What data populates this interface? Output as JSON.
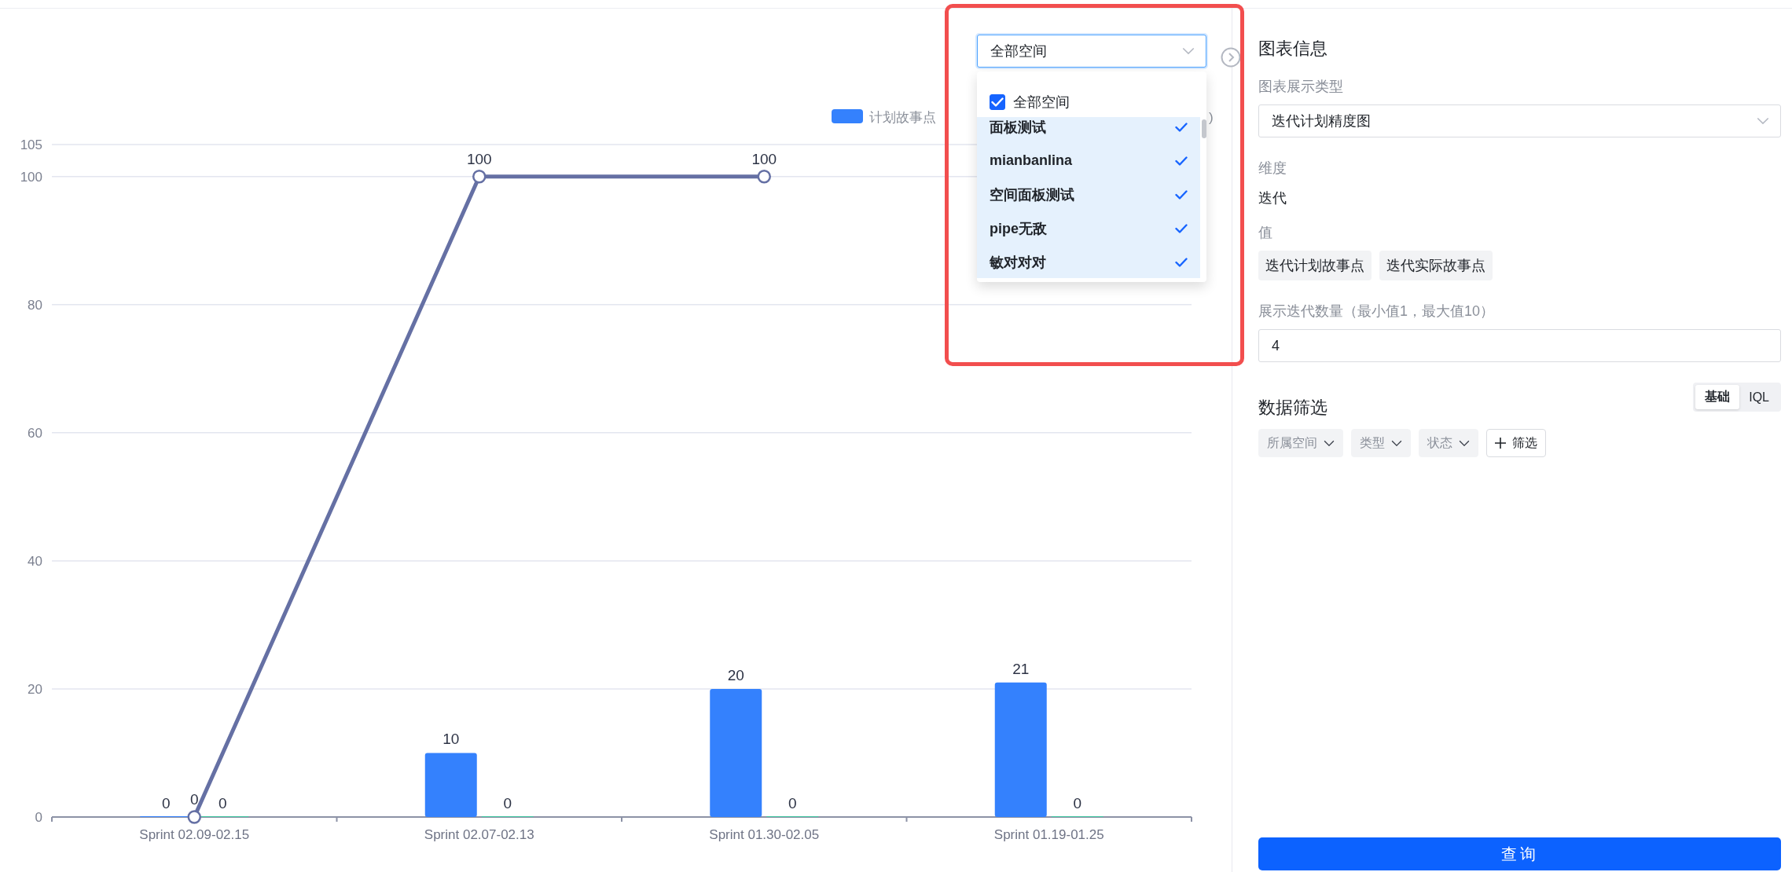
{
  "chart": {
    "legend_fragment": ")",
    "chart_data": {
      "type": "bar",
      "categories": [
        "Sprint 02.09-02.15",
        "Sprint 02.07-02.13",
        "Sprint 01.30-02.05",
        "Sprint 01.19-01.25"
      ],
      "series": [
        {
          "name": "计划故事点",
          "type": "bar",
          "color": "#3481fd",
          "values": [
            0,
            10,
            20,
            21
          ]
        },
        {
          "type": "bar",
          "color": "#3fc6a0",
          "values": [
            0,
            0,
            0,
            0
          ]
        },
        {
          "type": "line",
          "color": "#6570a4",
          "marker": "circle",
          "values": [
            0,
            100,
            100,
            null
          ]
        }
      ],
      "ylim": [
        0,
        105
      ],
      "yticks": [
        0,
        20,
        40,
        60,
        80,
        100,
        105
      ],
      "grid": true,
      "data_labels": true
    }
  },
  "space_select": {
    "value": "全部空间",
    "all_option": {
      "label": "全部空间",
      "checked": true
    },
    "options": [
      {
        "label": "面板测试",
        "selected": true
      },
      {
        "label": "mianbanlina",
        "selected": true
      },
      {
        "label": "空间面板测试",
        "selected": true
      },
      {
        "label": "pipe无敌",
        "selected": true
      },
      {
        "label": "敏对对对",
        "selected": true
      }
    ]
  },
  "panel": {
    "title": "图表信息",
    "chart_type": {
      "label": "图表展示类型",
      "value": "迭代计划精度图"
    },
    "dimension": {
      "label": "维度",
      "value": "迭代"
    },
    "values": {
      "label": "值",
      "tags": [
        "迭代计划故事点",
        "迭代实际故事点"
      ]
    },
    "count": {
      "label": "展示迭代数量（最小值1，最大值10）",
      "value": "4"
    },
    "filter": {
      "title": "数据筛选",
      "modes": [
        {
          "label": "基础",
          "selected": true
        },
        {
          "label": "IQL",
          "selected": false
        }
      ],
      "chips": [
        {
          "label": "所属空间",
          "kind": "dropdown"
        },
        {
          "label": "类型",
          "kind": "dropdown"
        },
        {
          "label": "状态",
          "kind": "dropdown"
        },
        {
          "label": "筛选",
          "kind": "add"
        }
      ]
    },
    "query_button": "查询"
  }
}
